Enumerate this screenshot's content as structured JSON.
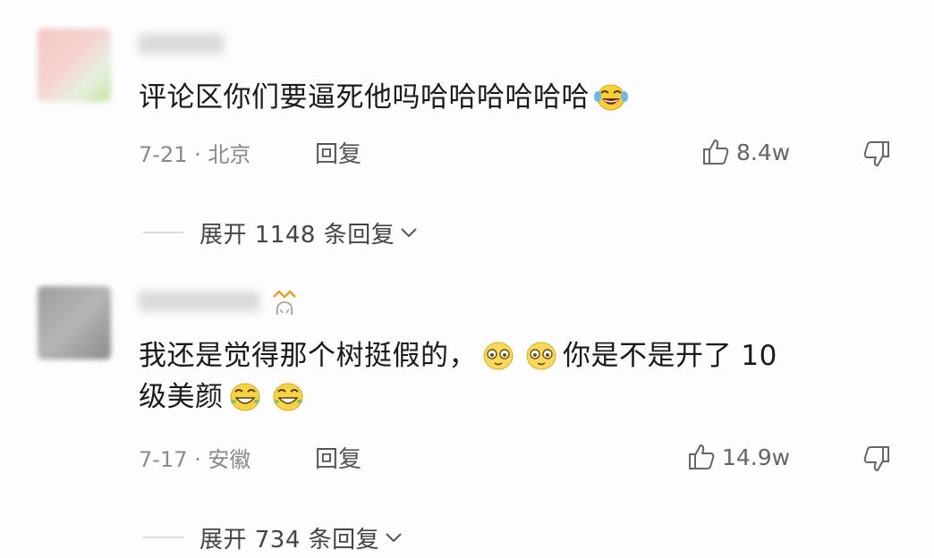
{
  "comments": [
    {
      "text": "评论区你们要逼死他吗哈哈哈哈哈哈",
      "date": "7-21 · 北京",
      "reply_label": "回复",
      "likes": "8.4w",
      "expand_label": "展开 1148 条回复"
    },
    {
      "text_part1": "我还是觉得那个树挺假的，",
      "text_part2": "你是不是开了 10",
      "text_line2": "级美颜",
      "date": "7-17 · 安徽",
      "reply_label": "回复",
      "likes": "14.9w",
      "expand_label": "展开 734 条回复"
    }
  ],
  "icons": {
    "thumb_up": "thumbs-up-icon",
    "thumb_down": "thumbs-down-icon",
    "chevron": "chevron-down-icon"
  },
  "colors": {
    "text": "#1a1a1a",
    "meta": "#8a8a8a",
    "emoji_yellow": "#f6cf3c"
  }
}
